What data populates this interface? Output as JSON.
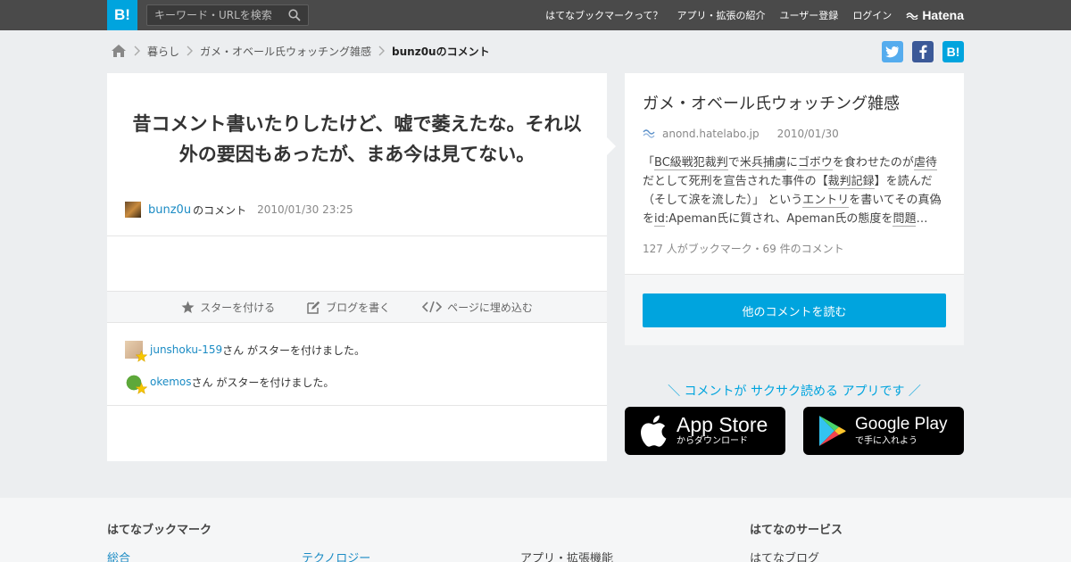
{
  "header": {
    "logo": "B!",
    "search_placeholder": "キーワード・URLを検索",
    "nav": [
      "はてなブックマークって？",
      "アプリ・拡張の紹介",
      "ユーザー登録",
      "ログイン"
    ],
    "brand": "Hatena"
  },
  "breadcrumb": {
    "items": [
      "暮らし",
      "ガメ・オベール氏ウォッチング雑感"
    ],
    "current": "bunz0uのコメント"
  },
  "share": {
    "twitter": "t",
    "facebook": "f",
    "hatena": "B!"
  },
  "comment": {
    "text": "昔コメント書いたりしたけど、嘘で萎えたな。それ以外の要因もあったが、まあ今は見てない。",
    "user": "bunz0u",
    "user_suffix": "のコメント",
    "datetime": "2010/01/30 23:25"
  },
  "actions": {
    "star": "スターを付ける",
    "blog": "ブログを書く",
    "embed": "ページに埋め込む"
  },
  "stars": [
    {
      "user": "junshoku-159",
      "text": "さん がスターを付けました。"
    },
    {
      "user": "okemos",
      "text": "さん がスターを付けました。"
    }
  ],
  "entry": {
    "title": "ガメ・オベール氏ウォッチング雑感",
    "domain": "anond.hatelabo.jp",
    "date": "2010/01/30",
    "excerpt": {
      "p1": "「",
      "k1": "BC級戦犯裁判",
      "p2": "で",
      "k2": "米兵捕虜",
      "p3": "に",
      "k3": "ゴボウ",
      "p4": "を食わせたのが",
      "k4": "虐待",
      "p5": "だとして死刑を宣告された事件の【",
      "k5": "裁判記録",
      "p6": "】を読んだ（そして涙を流した）」 という",
      "k6": "エントリ",
      "p7": "を書いてその真偽を",
      "k7": "id",
      "p8": ":Apeman氏に質され、Apeman氏の態度を",
      "k8": "問題",
      "p9": "…"
    },
    "counts": "127 人がブックマーク・69 件のコメント",
    "read_button": "他のコメントを読む"
  },
  "app_promo": {
    "tagline": "＼ コメントが サクサク読める アプリです ／",
    "apple_big": "App Store",
    "apple_small": "からダウンロード",
    "google_big": "Google Play",
    "google_small": "で手に入れよう"
  },
  "footer": {
    "heading1": "はてなブックマーク",
    "heading2": "はてなのサービス",
    "links": [
      "総合",
      "テクノロジー",
      "アプリ・拡張機能",
      "はてなブログ"
    ]
  },
  "colors": {
    "accent": "#00a4de",
    "link": "#1a8bc4",
    "topbar": "#4a4a4a"
  }
}
